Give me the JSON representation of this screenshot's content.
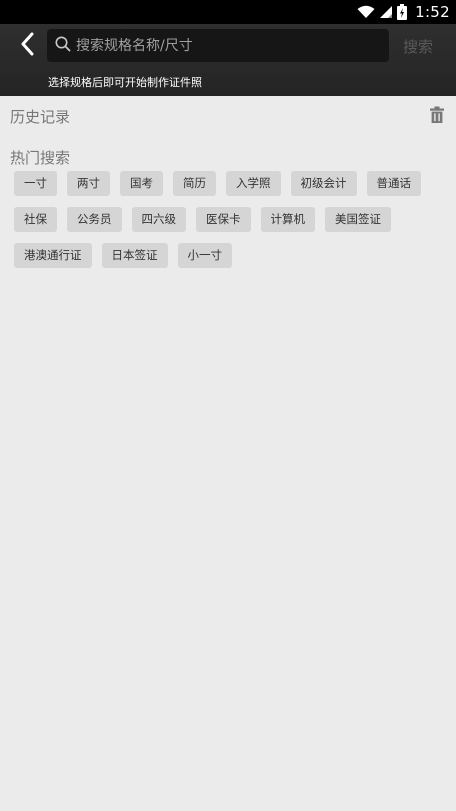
{
  "status_bar": {
    "time": "1:52",
    "icons": [
      "wifi-icon",
      "cell-signal-icon",
      "battery-icon"
    ]
  },
  "header": {
    "back_icon": "chevron-left-icon",
    "search_placeholder": "搜索规格名称/尺寸",
    "search_value": "",
    "search_button": "搜索",
    "hint": "选择规格后即可开始制作证件照"
  },
  "history": {
    "title": "历史记录",
    "clear_icon": "trash-icon"
  },
  "hot": {
    "title": "热门搜索",
    "tags": [
      "一寸",
      "两寸",
      "国考",
      "简历",
      "入学照",
      "初级会计",
      "普通话",
      "社保",
      "公务员",
      "四六级",
      "医保卡",
      "计算机",
      "美国签证",
      "港澳通行证",
      "日本签证",
      "小一寸"
    ]
  },
  "colors": {
    "header_bg": "#2a2a2a",
    "page_bg": "#ebebeb",
    "tag_bg": "#d5d5d5",
    "search_bg": "#161616"
  }
}
